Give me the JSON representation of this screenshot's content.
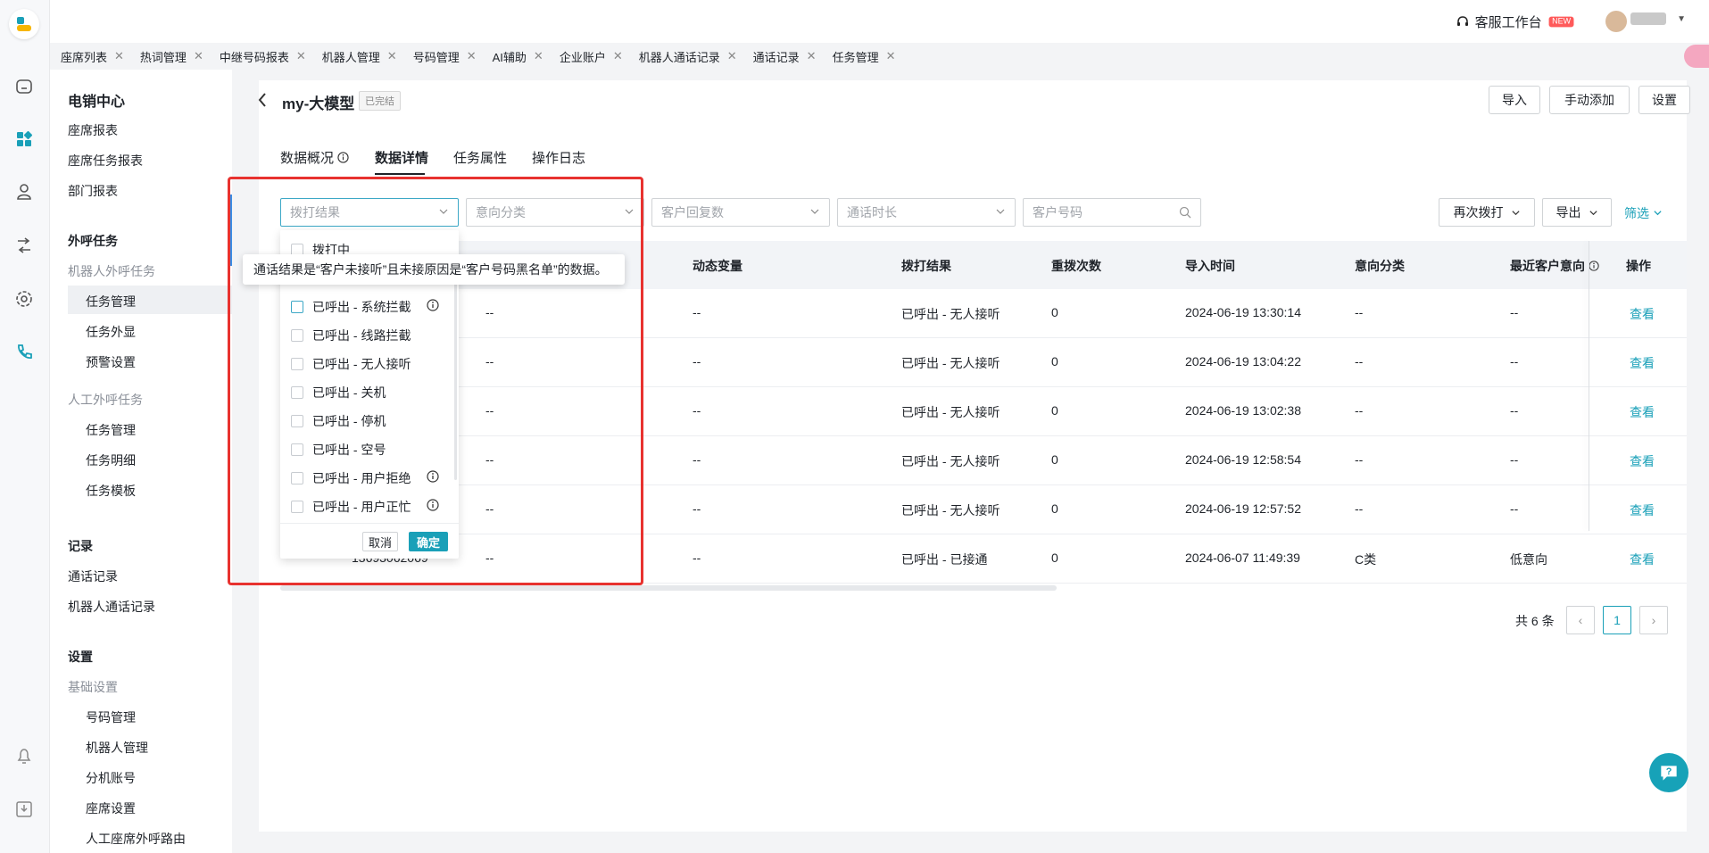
{
  "rail": {
    "icons": [
      "home-icon",
      "dashboard-icon",
      "user-icon",
      "route-icon",
      "settings-icon",
      "phone-icon",
      "bell-icon",
      "download-icon"
    ]
  },
  "topbar": {
    "workspace_label": "客服工作台",
    "new_badge": "NEW"
  },
  "page_tabs": [
    "座席列表",
    "热词管理",
    "中继号码报表",
    "机器人管理",
    "号码管理",
    "AI辅助",
    "企业账户",
    "机器人通话记录",
    "通话记录",
    "任务管理"
  ],
  "sidenav": {
    "title": "电销中心",
    "report_items": [
      "座席报表",
      "座席任务报表",
      "部门报表"
    ],
    "outbound_section": "外呼任务",
    "robot_group": "机器人外呼任务",
    "robot_items": [
      "任务管理",
      "任务外显",
      "预警设置"
    ],
    "manual_group": "人工外呼任务",
    "manual_items": [
      "任务管理",
      "任务明细",
      "任务模板"
    ],
    "records_section": "记录",
    "records_items": [
      "通话记录",
      "机器人通话记录"
    ],
    "settings_section": "设置",
    "basic_group": "基础设置",
    "basic_items": [
      "号码管理",
      "机器人管理",
      "分机账号",
      "座席设置",
      "人工座席外呼路由"
    ]
  },
  "header": {
    "task_name": "my-大模型",
    "status": "已完结",
    "buttons": [
      "导入",
      "手动添加",
      "设置"
    ]
  },
  "subtabs": [
    "数据概况",
    "数据详情",
    "任务属性",
    "操作日志"
  ],
  "filters": {
    "dial_result": "拨打结果",
    "intent": "意向分类",
    "reply_count": "客户回复数",
    "duration": "通话时长",
    "phone": "客户号码",
    "redial": "再次拨打",
    "export": "导出",
    "filter_link": "筛选"
  },
  "table": {
    "headers": [
      "动态变量",
      "拨打结果",
      "重拨次数",
      "导入时间",
      "意向分类",
      "最近客户意向",
      "操作"
    ],
    "rows": [
      {
        "col2": "--",
        "var": "--",
        "result": "已呼出 - 无人接听",
        "redial": "0",
        "time": "2024-06-19 13:30:14",
        "intent": "--",
        "recent": "--",
        "op": "查看"
      },
      {
        "col2": "--",
        "var": "--",
        "result": "已呼出 - 无人接听",
        "redial": "0",
        "time": "2024-06-19 13:04:22",
        "intent": "--",
        "recent": "--",
        "op": "查看"
      },
      {
        "col2": "--",
        "var": "--",
        "result": "已呼出 - 无人接听",
        "redial": "0",
        "time": "2024-06-19 13:02:38",
        "intent": "--",
        "recent": "--",
        "op": "查看"
      },
      {
        "col2": "--",
        "var": "--",
        "result": "已呼出 - 无人接听",
        "redial": "0",
        "time": "2024-06-19 12:58:54",
        "intent": "--",
        "recent": "--",
        "op": "查看"
      },
      {
        "col2": "--",
        "var": "--",
        "result": "已呼出 - 无人接听",
        "redial": "0",
        "time": "2024-06-19 12:57:52",
        "intent": "--",
        "recent": "--",
        "op": "查看"
      },
      {
        "phone": "13693062069",
        "col2": "--",
        "var": "--",
        "result": "已呼出 - 已接通",
        "redial": "0",
        "time": "2024-06-07 11:49:39",
        "intent": "C类",
        "recent": "低意向",
        "op": "查看"
      }
    ]
  },
  "pagination": {
    "total": "共 6 条",
    "current": "1"
  },
  "dropdown": {
    "options": [
      "拨打中",
      "已呼出 - 系统拦截",
      "已呼出 - 线路拦截",
      "已呼出 - 无人接听",
      "已呼出 - 关机",
      "已呼出 - 停机",
      "已呼出 - 空号",
      "已呼出 - 用户拒绝",
      "已呼出 - 用户正忙"
    ],
    "cancel": "取消",
    "confirm": "确定"
  },
  "tooltip": "通话结果是“客户未接听”且未接原因是“客户号码黑名单”的数据。"
}
